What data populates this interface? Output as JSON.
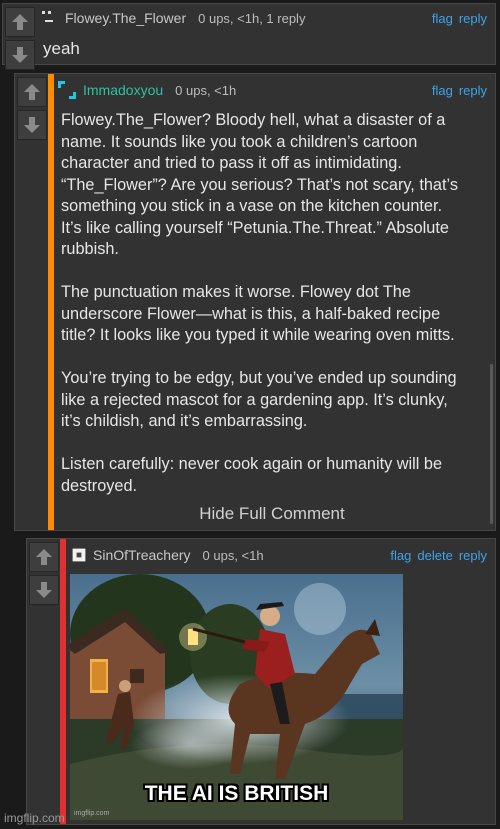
{
  "comments": [
    {
      "username": "Flowey.The_Flower",
      "meta": "0 ups, <1h, 1 reply",
      "actions": [
        "flag",
        "reply"
      ],
      "body": "yeah"
    },
    {
      "username": "Immadoxyou",
      "meta": "0 ups, <1h",
      "actions": [
        "flag",
        "reply"
      ],
      "accent_color": "#ff8c00",
      "paragraphs": [
        "Flowey.The_Flower? Bloody hell, what a disaster of a\nname. It sounds like you took a children’s cartoon\ncharacter and tried to pass it off as intimidating.\n“The_Flower”? Are you serious? That’s not scary, that’s\nsomething you stick in a vase on the kitchen counter.\nIt’s like calling yourself “Petunia.The.Threat.” Absolute\nrubbish.",
        "The punctuation makes it worse. Flowey dot The\nunderscore Flower—what is this, a half-baked recipe\ntitle? It looks like you typed it while wearing oven mitts.",
        "You’re trying to be edgy, but you’ve ended up sounding\nlike a rejected mascot for a gardening app. It’s clunky,\nit’s childish, and it’s embarrassing.",
        "Listen carefully: never cook again or humanity will be\ndestroyed."
      ],
      "hide_label": "Hide Full Comment"
    },
    {
      "username": "SinOfTreachery",
      "meta": "0 ups, <1h",
      "actions": [
        "flag",
        "delete",
        "reply"
      ],
      "accent_color": "#e03030",
      "meme_caption": "THE AI IS BRITISH",
      "meme_watermark": "imgflip.com"
    }
  ],
  "footer_watermark": "imgflip.com",
  "icons": {
    "upvote": "arrow-up-icon",
    "downvote": "arrow-down-icon"
  },
  "colors": {
    "link": "#3ea3e8",
    "teal_user": "#2fc1a1"
  }
}
